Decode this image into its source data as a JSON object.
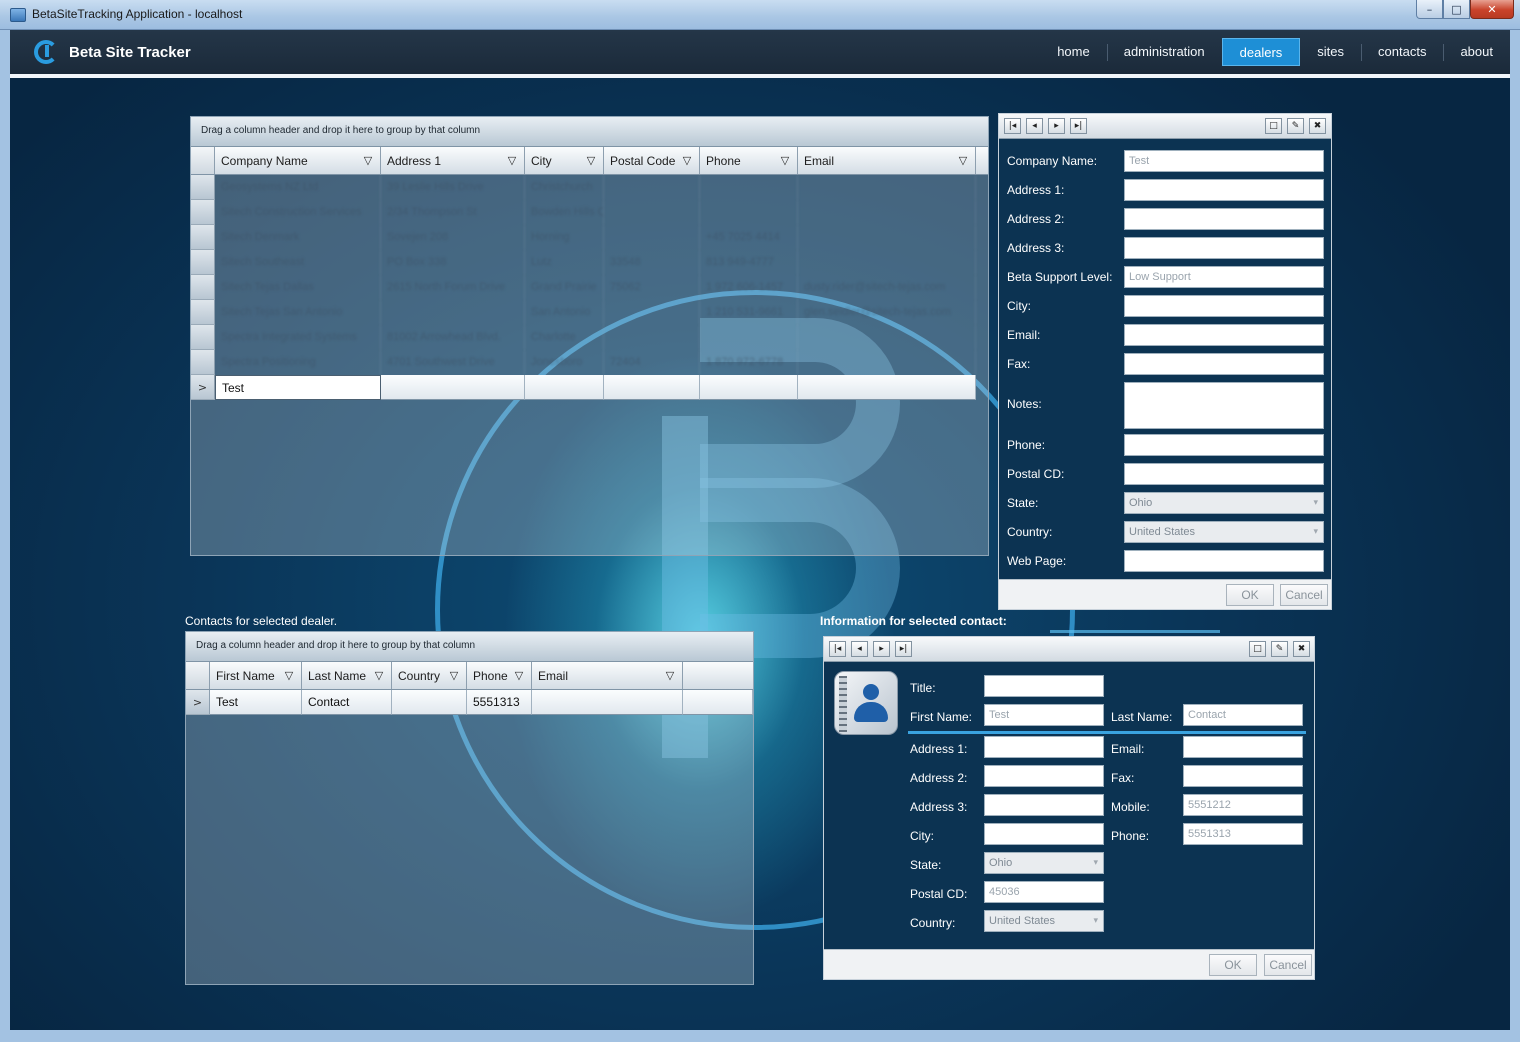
{
  "window": {
    "title": "BetaSiteTracking Application - localhost",
    "controls": {
      "minimize": "–",
      "maximize": "□",
      "close": "✕"
    }
  },
  "header": {
    "brand": "Beta Site Tracker",
    "nav": [
      {
        "label": "home",
        "active": false
      },
      {
        "label": "administration",
        "active": false
      },
      {
        "label": "dealers",
        "active": true
      },
      {
        "label": "sites",
        "active": false
      },
      {
        "label": "contacts",
        "active": false
      },
      {
        "label": "about",
        "active": false
      }
    ]
  },
  "dealers_grid": {
    "group_prompt": "Drag a column header and drop it here to group by that column",
    "columns": [
      "Company Name",
      "Address 1",
      "City",
      "Postal Code",
      "Phone",
      "Email"
    ],
    "rows": [
      [
        "Geosystems NZ Ltd",
        "39 Leslie Hills Drive",
        "Christchurch",
        "",
        "",
        ""
      ],
      [
        "Sitech Construction Services",
        "2/34 Thompson St",
        "Bowden Hills  QLD 4006",
        "",
        "",
        ""
      ],
      [
        "Sitech Denmark",
        "Sovejen 208",
        "Horning",
        "",
        "+45 7025 4414",
        ""
      ],
      [
        "Sitech Southeast",
        "PO Box 338",
        "Lutz",
        "33548",
        "813 949-4777",
        ""
      ],
      [
        "Sitech Tejas Dallas",
        "2615 North Forum Drive",
        "Grand Prairie",
        "75062",
        "1 972 606-1457",
        "dusty.rider@sitech-tejas.com"
      ],
      [
        "Sitech Tejas San Antonio",
        "",
        "San Antonio",
        "",
        "1 210 531-9661",
        "glen.seidler@sitech-tejas.com"
      ],
      [
        "Spectra Integrated Systems",
        "81002 Arrowhead Blvd.",
        "Charlotte",
        "",
        "",
        ""
      ],
      [
        "Spectra Positioning",
        "4701 Southwest Drive",
        "Jonesboro",
        "72404",
        "1 870 972-6778",
        ""
      ]
    ],
    "selected_row": [
      "Test",
      "",
      "",
      "",
      "",
      ""
    ],
    "row_indicator": ">"
  },
  "dealer_form": {
    "ok": "OK",
    "cancel": "Cancel",
    "fields": {
      "company_name": {
        "label": "Company Name:",
        "value": "Test"
      },
      "address1": {
        "label": "Address 1:",
        "value": ""
      },
      "address2": {
        "label": "Address 2:",
        "value": ""
      },
      "address3": {
        "label": "Address 3:",
        "value": ""
      },
      "support_level": {
        "label": "Beta Support Level:",
        "value": "Low Support"
      },
      "city": {
        "label": "City:",
        "value": ""
      },
      "email": {
        "label": "Email:",
        "value": ""
      },
      "fax": {
        "label": "Fax:",
        "value": ""
      },
      "notes": {
        "label": "Notes:",
        "value": ""
      },
      "phone": {
        "label": "Phone:",
        "value": ""
      },
      "postal": {
        "label": "Postal CD:",
        "value": ""
      },
      "state": {
        "label": "State:",
        "value": "Ohio"
      },
      "country": {
        "label": "Country:",
        "value": "United States"
      },
      "webpage": {
        "label": "Web Page:",
        "value": ""
      }
    }
  },
  "contacts_section": {
    "label": "Contacts for selected dealer.",
    "group_prompt": "Drag a column header and drop it here to group by that column",
    "columns": [
      "First Name",
      "Last Name",
      "Country",
      "Phone",
      "Email"
    ],
    "selected_row": [
      "Test",
      "Contact",
      "",
      "5551313",
      ""
    ],
    "row_indicator": ">"
  },
  "contact_form": {
    "label": "Information for selected contact:",
    "ok": "OK",
    "cancel": "Cancel",
    "fields": {
      "title": {
        "label": "Title:",
        "value": ""
      },
      "first_name": {
        "label": "First Name:",
        "value": "Test"
      },
      "last_name": {
        "label": "Last Name:",
        "value": "Contact"
      },
      "address1": {
        "label": "Address 1:",
        "value": ""
      },
      "address2": {
        "label": "Address 2:",
        "value": ""
      },
      "address3": {
        "label": "Address 3:",
        "value": ""
      },
      "city": {
        "label": "City:",
        "value": ""
      },
      "state": {
        "label": "State:",
        "value": "Ohio"
      },
      "postal": {
        "label": "Postal CD:",
        "value": "45036"
      },
      "country": {
        "label": "Country:",
        "value": "United States"
      },
      "email": {
        "label": "Email:",
        "value": ""
      },
      "fax": {
        "label": "Fax:",
        "value": ""
      },
      "mobile": {
        "label": "Mobile:",
        "value": "5551212"
      },
      "phone": {
        "label": "Phone:",
        "value": "5551313"
      }
    }
  },
  "toolbar_icons": [
    "first-record-icon",
    "previous-record-icon",
    "next-record-icon",
    "last-record-icon",
    "new-record-icon",
    "edit-record-icon",
    "delete-record-icon"
  ]
}
